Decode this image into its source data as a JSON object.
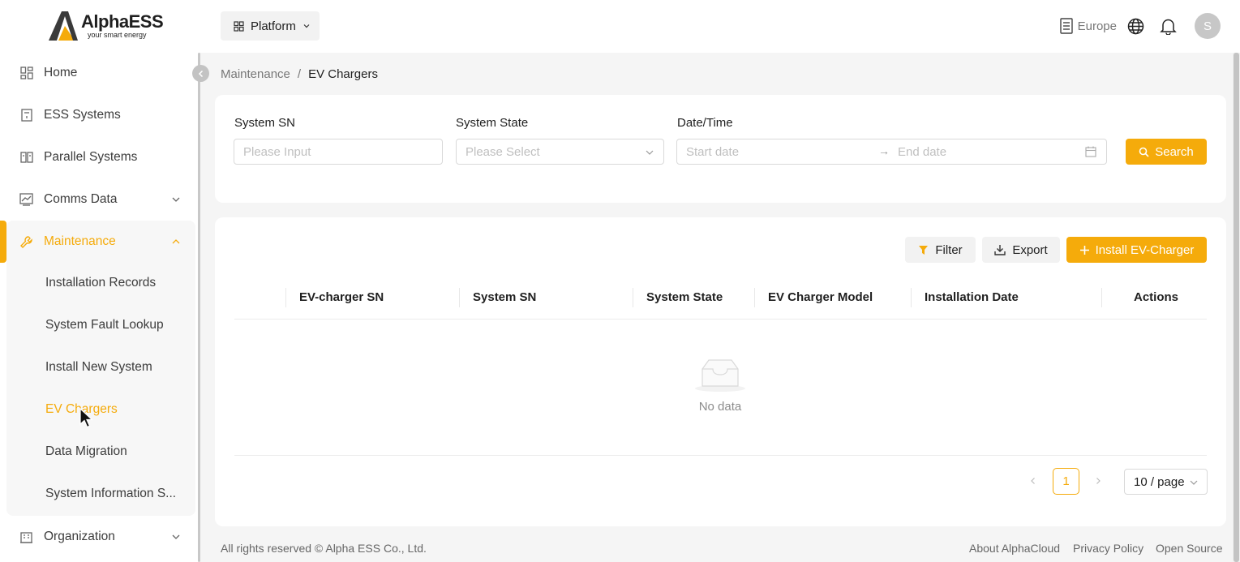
{
  "logo": {
    "brand": "AlphaESS",
    "tagline": "your smart energy"
  },
  "sidebar": {
    "items": [
      {
        "label": "Home",
        "icon": "home-grid-icon"
      },
      {
        "label": "ESS Systems",
        "icon": "document-icon"
      },
      {
        "label": "Parallel Systems",
        "icon": "book-icon"
      },
      {
        "label": "Comms Data",
        "icon": "chart-icon",
        "expandable": true
      },
      {
        "label": "Maintenance",
        "icon": "wrench-icon",
        "expandable": true,
        "expanded": true,
        "active": true
      },
      {
        "label": "Organization",
        "icon": "building-icon",
        "expandable": true
      }
    ],
    "maintenance_sub": [
      {
        "label": "Installation Records"
      },
      {
        "label": "System Fault Lookup"
      },
      {
        "label": "Install New System"
      },
      {
        "label": "EV Chargers",
        "active": true
      },
      {
        "label": "Data Migration"
      },
      {
        "label": "System Information S..."
      }
    ]
  },
  "topbar": {
    "platform_label": "Platform",
    "region": "Europe",
    "avatar_initial": "S"
  },
  "breadcrumb": {
    "parent": "Maintenance",
    "separator": "/",
    "current": "EV Chargers"
  },
  "filters": {
    "system_sn": {
      "label": "System SN",
      "placeholder": "Please Input"
    },
    "system_state": {
      "label": "System State",
      "placeholder": "Please Select"
    },
    "datetime": {
      "label": "Date/Time",
      "start_placeholder": "Start date",
      "end_placeholder": "End date"
    },
    "search_label": "Search"
  },
  "toolbar": {
    "filter_label": "Filter",
    "export_label": "Export",
    "install_label": "Install EV-Charger"
  },
  "table": {
    "columns": [
      "EV-charger SN",
      "System SN",
      "System State",
      "EV Charger Model",
      "Installation Date",
      "Actions"
    ],
    "rows": [],
    "empty_text": "No data"
  },
  "pagination": {
    "current_page": "1",
    "page_size": "10 / page"
  },
  "footer": {
    "copyright": "All rights reserved © Alpha ESS Co., Ltd.",
    "links": [
      "About AlphaCloud",
      "Privacy Policy",
      "Open Source"
    ]
  },
  "colors": {
    "accent": "#f5ab0b",
    "background": "#f5f5f5"
  }
}
